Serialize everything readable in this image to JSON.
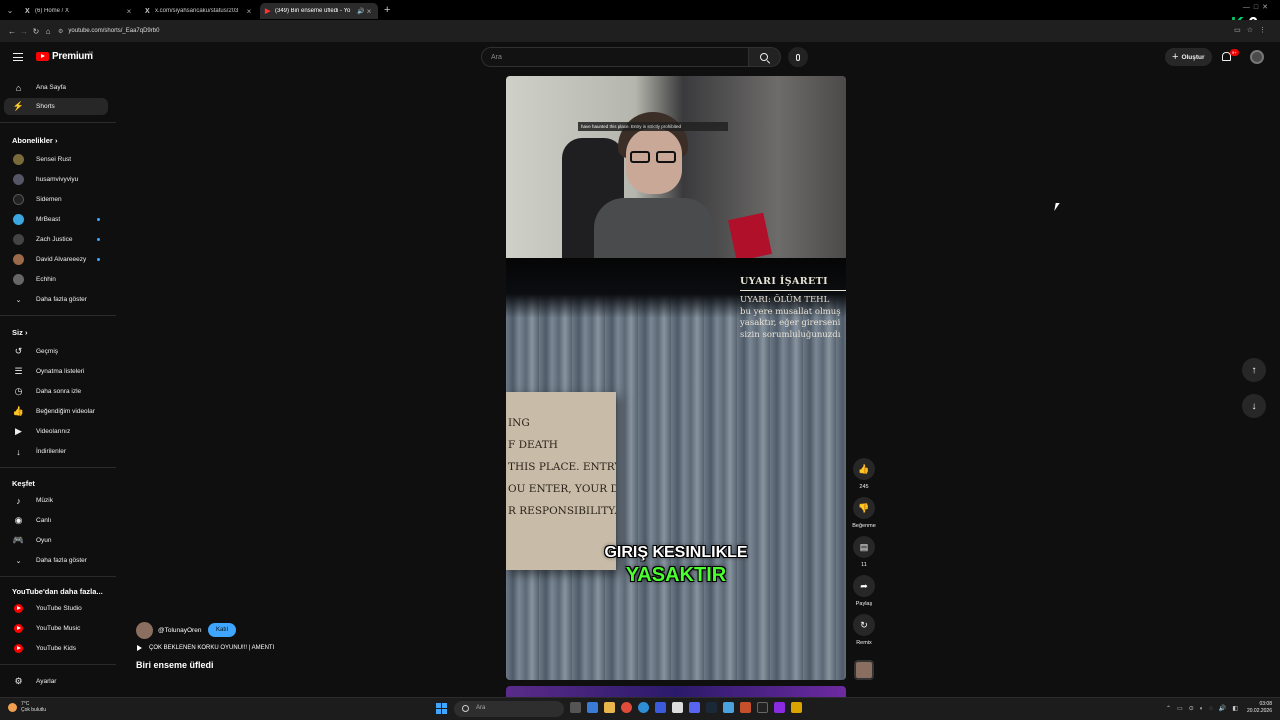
{
  "browser": {
    "tabs": [
      {
        "title": "(6) Home / X",
        "favicon": "x-logo-icon"
      },
      {
        "title": "x.com/siyahsancaku/status/203",
        "favicon": "x-logo-icon"
      },
      {
        "title": "(349) Biri enseme üfledi - Yo",
        "favicon": "youtube-icon",
        "active": true
      }
    ],
    "url": "youtube.com/shorts/_Eaa7qD9rb0",
    "overlay_badge": {
      "letter": "K",
      "number": "6"
    }
  },
  "header": {
    "logo_text": "Premium",
    "logo_sup": "TR",
    "search_placeholder": "Ara",
    "create_label": "Oluştur",
    "notification_count": "9+"
  },
  "sidebar": {
    "main": [
      {
        "label": "Ana Sayfa",
        "icon": "home-icon"
      },
      {
        "label": "Shorts",
        "icon": "shorts-icon",
        "active": true
      }
    ],
    "subscriptions_header": "Abonelikler",
    "subscriptions": [
      {
        "label": "Sensei Rust",
        "color": "#7a6a3a"
      },
      {
        "label": "husamvivyviyu",
        "color": "#555566"
      },
      {
        "label": "Sidemen",
        "color": "#222222"
      },
      {
        "label": "MrBeast",
        "color": "#3aa7e0",
        "new": true
      },
      {
        "label": "Zach Justice",
        "color": "#444444",
        "new": true
      },
      {
        "label": "David Alvareeezy",
        "color": "#9a6a4a",
        "new": true
      },
      {
        "label": "Echhin",
        "color": "#666666"
      }
    ],
    "subscriptions_more": "Daha fazla göster",
    "you_header": "Siz",
    "you": [
      {
        "label": "Geçmiş",
        "icon": "history-icon"
      },
      {
        "label": "Oynatma listeleri",
        "icon": "playlist-icon"
      },
      {
        "label": "Daha sonra izle",
        "icon": "watch-later-icon"
      },
      {
        "label": "Beğendiğim videolar",
        "icon": "like-icon"
      },
      {
        "label": "Videolarınız",
        "icon": "your-videos-icon"
      },
      {
        "label": "İndirilenler",
        "icon": "download-icon"
      }
    ],
    "explore_header": "Keşfet",
    "explore": [
      {
        "label": "Müzik",
        "icon": "music-icon"
      },
      {
        "label": "Canlı",
        "icon": "live-icon"
      },
      {
        "label": "Oyun",
        "icon": "gaming-icon"
      },
      {
        "label": "Daha fazla göster",
        "icon": "chevron-down-icon"
      }
    ],
    "more_header": "YouTube'dan daha fazla...",
    "more": [
      {
        "label": "YouTube Studio"
      },
      {
        "label": "YouTube Music"
      },
      {
        "label": "YouTube Kids"
      }
    ],
    "settings_label": "Ayarlar"
  },
  "short": {
    "webcam_caption": "have haunted this place. Entry is strictly prohibited",
    "warning_title": "UYARI İŞARETI",
    "warning_lines": [
      "UYARI: ÖLÜM TEHL",
      "bu yere musallat olmuş",
      "yasaktır, eğer girerseni",
      "sizin sorumluluğunuzdı"
    ],
    "sign_lines": [
      "ING",
      "F DEATH",
      "THIS PLACE. ENTRY IS",
      "OU ENTER, YOUR DEATH",
      "R RESPONSIBILITY."
    ],
    "subtitle_line1": "GIRIŞ KESINLIKLE",
    "subtitle_line2": "YASAKTIR",
    "channel": "@TolunayOren",
    "join_label": "Katıl",
    "music": "ÇOK BEKLENEN KORKU OYUNU!!! | AMENTI",
    "title": "Biri enseme üfledi"
  },
  "actions": {
    "like_count": "245",
    "dislike_label": "Beğenme",
    "comment_count": "11",
    "share_label": "Paylaş",
    "remix_label": "Remix"
  },
  "taskbar": {
    "weather_temp": "7°C",
    "weather_desc": "Çok bulutlu",
    "search_label": "Ara",
    "time": "03:08",
    "date": "20.02.2026"
  }
}
